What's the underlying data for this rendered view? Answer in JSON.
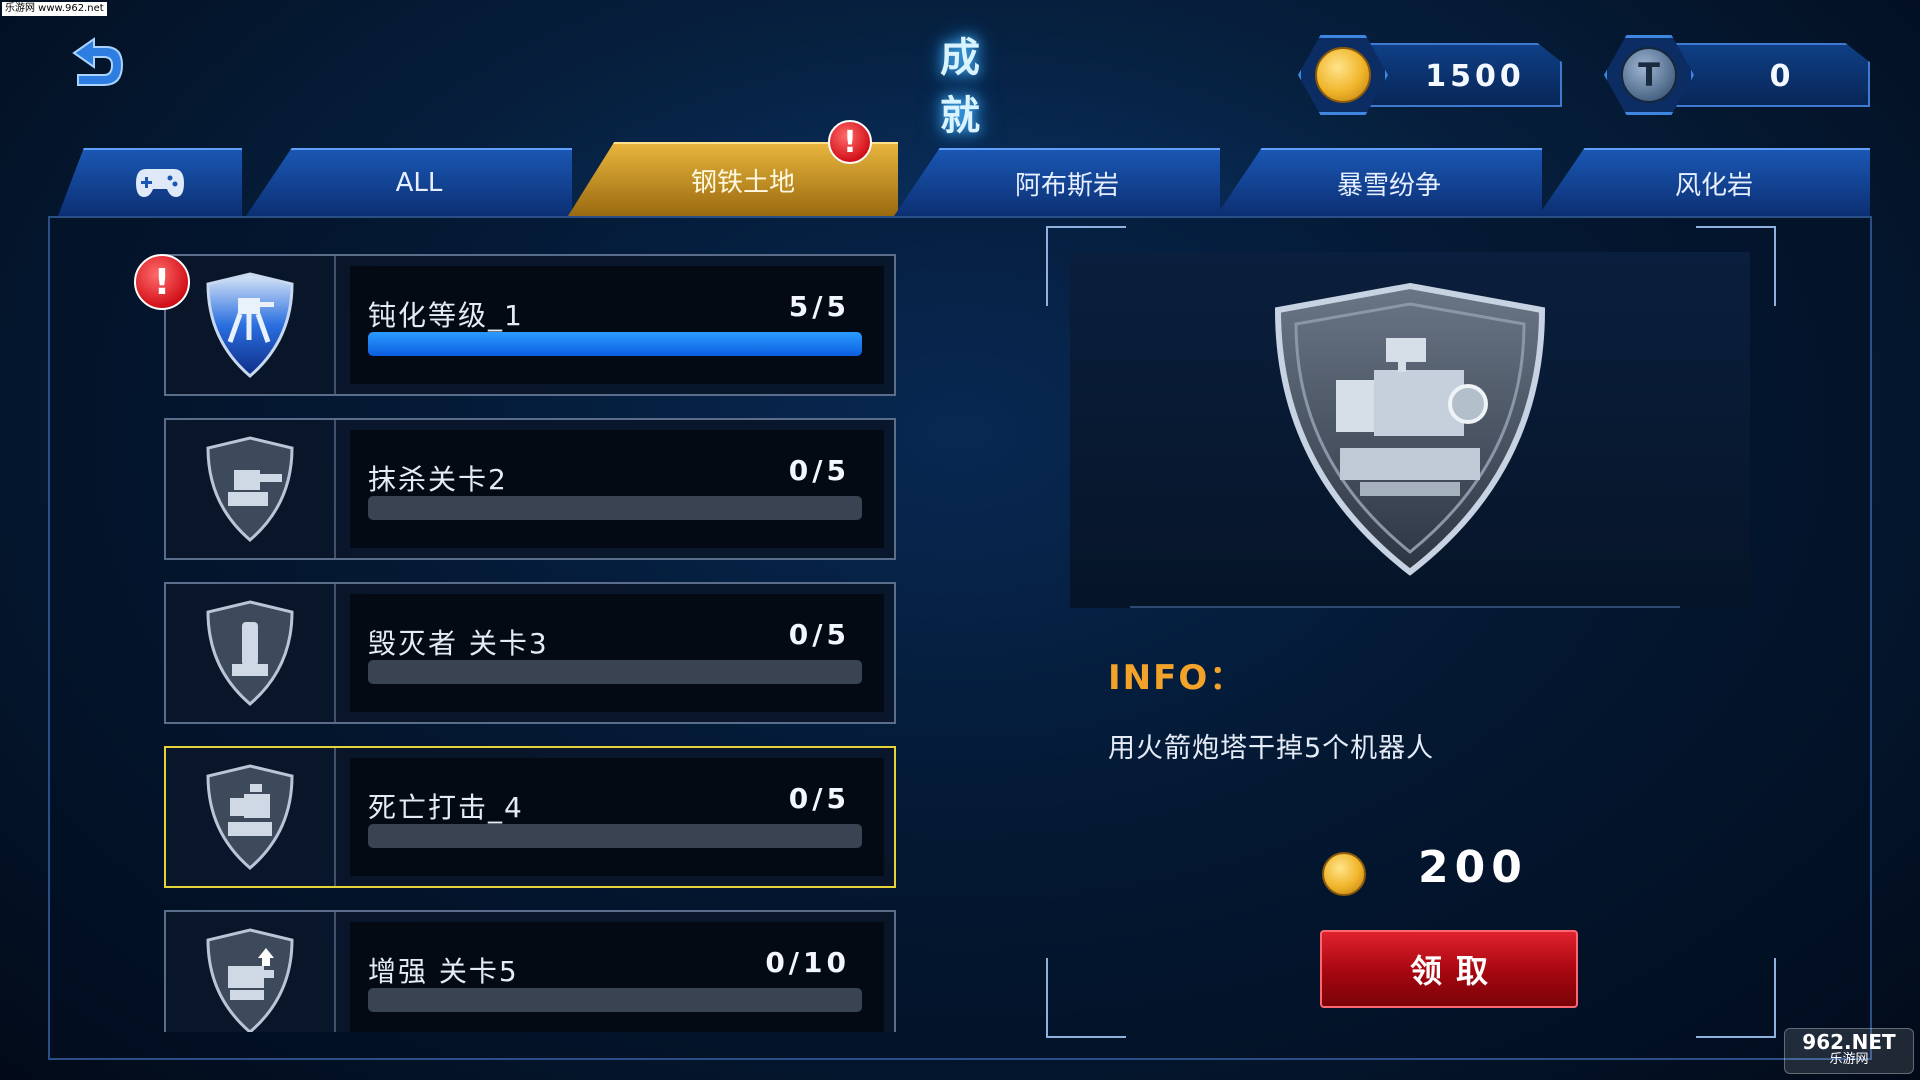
{
  "watermark_top": "乐游网 www.962.net",
  "header": {
    "title": "成 就",
    "back_icon": "undo-arrow-icon"
  },
  "currencies": [
    {
      "icon": "gold-coin-icon",
      "value": "1500"
    },
    {
      "icon": "t-token-icon",
      "value": "0",
      "glyph": "T"
    }
  ],
  "tabs": [
    {
      "label": "",
      "icon": "gamepad-icon"
    },
    {
      "label": "ALL"
    },
    {
      "label": "钢铁土地",
      "active": true,
      "alert": "!"
    },
    {
      "label": "阿布斯岩"
    },
    {
      "label": "暴雪纷争"
    },
    {
      "label": "风化岩"
    }
  ],
  "achievements": [
    {
      "name": "钝化等级_1",
      "progress_text": "5/5",
      "progress": 1.0,
      "icon": "walker-mech-shield-icon",
      "alert": "!"
    },
    {
      "name": "抹杀关卡2",
      "progress_text": "0/5",
      "progress": 0.0,
      "icon": "cannon-turret-shield-icon"
    },
    {
      "name": "毁灭者 关卡3",
      "progress_text": "0/5",
      "progress": 0.0,
      "icon": "tower-turret-shield-icon"
    },
    {
      "name": "死亡打击_4",
      "progress_text": "0/5",
      "progress": 0.0,
      "icon": "rocket-turret-shield-icon",
      "selected": true
    },
    {
      "name": "增强 关卡5",
      "progress_text": "0/10",
      "progress": 0.0,
      "icon": "upgrade-turret-shield-icon"
    }
  ],
  "detail": {
    "preview_icon": "rocket-turret-shield-icon",
    "info_label": "INFO：",
    "info_text": "用火箭炮塔干掉5个机器人",
    "reward_icon": "gold-coin-icon",
    "reward_value": "200",
    "claim_label": "领取"
  },
  "watermark_br": {
    "brand": "962.NET",
    "sub": "乐游网"
  },
  "colors": {
    "active_tab": "#e7b53c",
    "tab": "#1a57b3",
    "progress_fill": "#0c5ee0",
    "selected_border": "#e6d33a",
    "info_label": "#f3a32a",
    "claim_button": "#c0101a",
    "alert": "#d3121a"
  }
}
